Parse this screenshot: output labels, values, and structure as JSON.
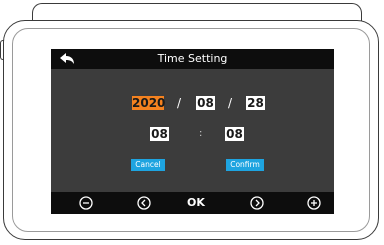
{
  "header": {
    "title": "Time Setting",
    "back_icon": "arrow-back-icon"
  },
  "date": {
    "year": "2020",
    "month": "08",
    "day": "28",
    "separator": "/"
  },
  "time": {
    "hour": "08",
    "minute": "08",
    "separator": ":"
  },
  "buttons": {
    "cancel": "Cancel",
    "confirm": "Confirm"
  },
  "nav": {
    "ok_label": "OK",
    "icons": [
      "minus-circle-icon",
      "chevron-left-circle-icon",
      "chevron-right-circle-icon",
      "plus-circle-icon"
    ]
  },
  "colors": {
    "accent_selected": "#f5821f",
    "button": "#1ea4e0",
    "screen_bg": "#3c3c3c",
    "bar_bg": "#0d0d0d"
  }
}
